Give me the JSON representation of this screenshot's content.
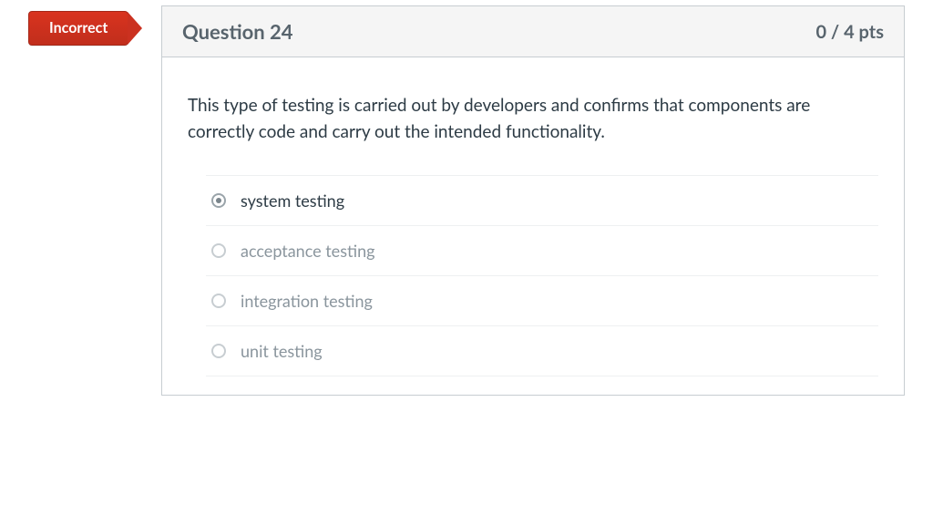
{
  "badge": {
    "label": "Incorrect",
    "color": "#cb3120"
  },
  "header": {
    "title": "Question 24",
    "points": "0 / 4 pts"
  },
  "question": {
    "text": "This type of testing is carried out by developers and confirms that components are correctly code and carry out the intended functionality."
  },
  "options": [
    {
      "label": "system testing",
      "selected": true
    },
    {
      "label": "acceptance testing",
      "selected": false
    },
    {
      "label": "integration testing",
      "selected": false
    },
    {
      "label": "unit testing",
      "selected": false
    }
  ]
}
